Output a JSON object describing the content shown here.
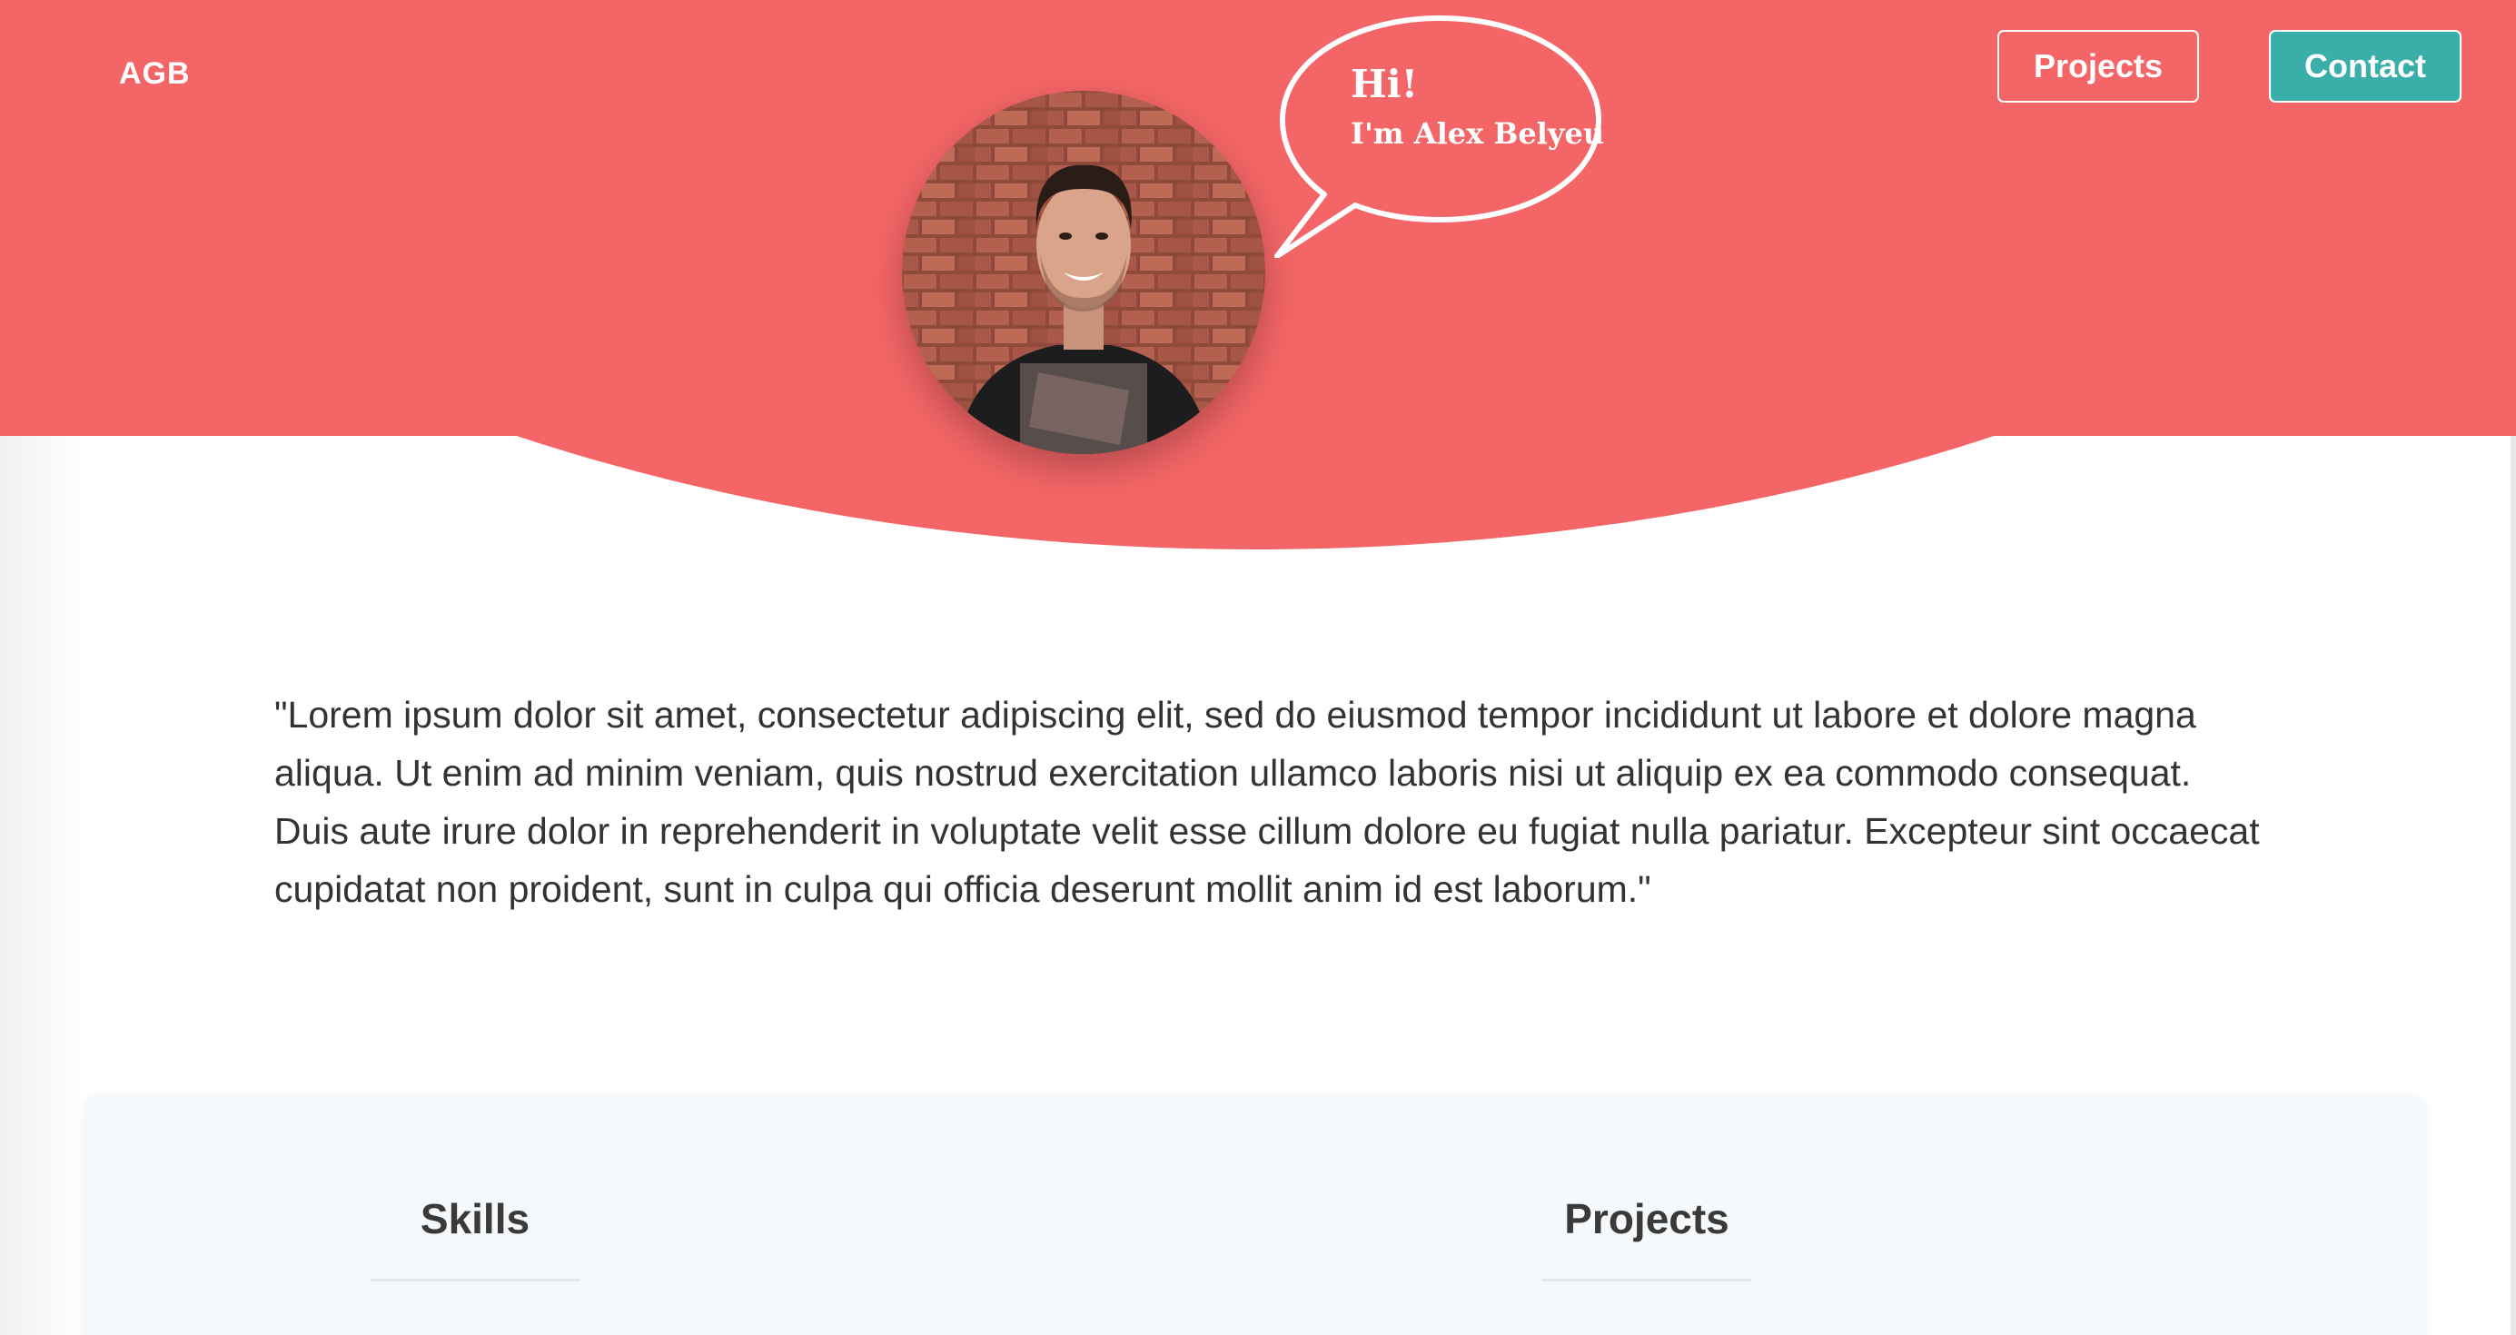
{
  "header": {
    "logo": "AGB",
    "nav": {
      "projects_label": "Projects",
      "contact_label": "Contact"
    }
  },
  "hero": {
    "greeting": "Hi!",
    "intro": "I'm Alex Belyeu"
  },
  "about": {
    "quote": "\"Lorem ipsum dolor sit amet, consectetur adipiscing elit, sed do eiusmod tempor incididunt ut labore et dolore magna aliqua. Ut enim ad minim veniam, quis nostrud exercitation ullamco laboris nisi ut aliquip ex ea commodo consequat. Duis aute irure dolor in reprehenderit in voluptate velit esse cillum dolore eu fugiat nulla pariatur. Excepteur sint occaecat cupidatat non proident, sunt in culpa qui officia deserunt mollit anim id est laborum.\""
  },
  "sections": {
    "skills_title": "Skills",
    "projects_title": "Projects"
  },
  "colors": {
    "brand": "#f46567",
    "accent": "#3aafa9",
    "panel": "#f6f9fb"
  }
}
